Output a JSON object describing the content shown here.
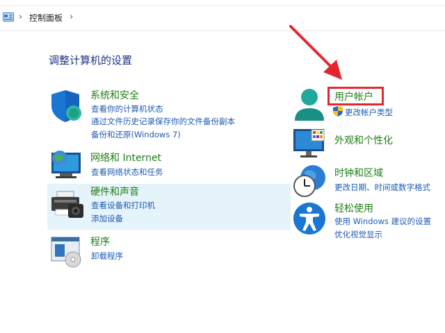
{
  "breadcrumb": {
    "path": [
      "控制面板"
    ]
  },
  "page_title": "调整计算机的设置",
  "left_categories": [
    {
      "title": "系统和安全",
      "links": [
        "查看你的计算机状态",
        "通过文件历史记录保存你的文件备份副本",
        "备份和还原(Windows 7)"
      ]
    },
    {
      "title": "网络和 Internet",
      "links": [
        "查看网络状态和任务"
      ]
    },
    {
      "title": "硬件和声音",
      "links": [
        "查看设备和打印机",
        "添加设备"
      ]
    },
    {
      "title": "程序",
      "links": [
        "卸载程序"
      ]
    }
  ],
  "right_categories": [
    {
      "title": "用户帐户",
      "links": [
        "更改帐户类型"
      ]
    },
    {
      "title": "外观和个性化",
      "links": []
    },
    {
      "title": "时钟和区域",
      "links": [
        "更改日期、时间或数字格式"
      ]
    },
    {
      "title": "轻松使用",
      "links": [
        "使用 Windows 建议的设置",
        "优化视觉显示"
      ]
    }
  ],
  "icons": {
    "control_panel": "control-panel-icon",
    "system_security": "shield-icon",
    "network": "globe-monitor-icon",
    "hardware": "printer-camera-icon",
    "programs": "programs-disc-icon",
    "user_accounts": "user-icon",
    "appearance": "monitor-palette-icon",
    "clock": "clock-globe-icon",
    "ease_of_access": "accessibility-icon",
    "uac": "uac-shield-icon"
  },
  "colors": {
    "category_title": "#1e7e14",
    "link": "#1e5bb5",
    "page_title": "#1e3287",
    "highlight": "#e5262e",
    "hover_bg": "#e5f3fb"
  }
}
